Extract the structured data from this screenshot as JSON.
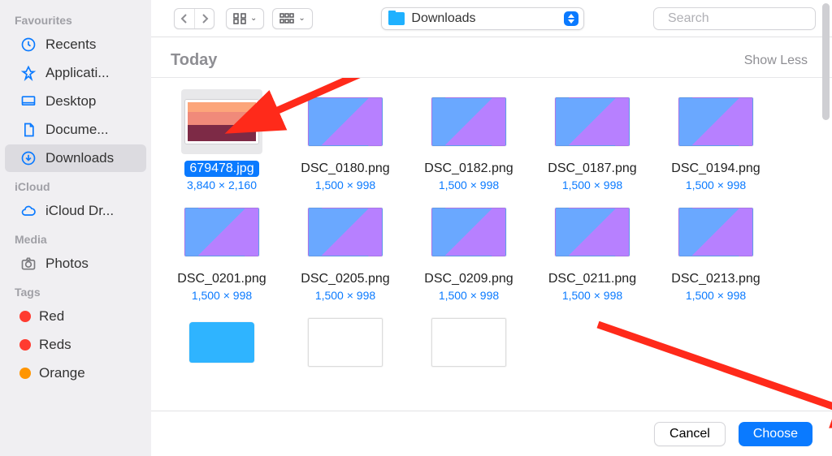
{
  "sidebar": {
    "sections": [
      {
        "label": "Favourites",
        "items": [
          {
            "id": "recents",
            "label": "Recents",
            "icon": "clock"
          },
          {
            "id": "applications",
            "label": "Applicati...",
            "icon": "app"
          },
          {
            "id": "desktop",
            "label": "Desktop",
            "icon": "desktop"
          },
          {
            "id": "documents",
            "label": "Docume...",
            "icon": "doc"
          },
          {
            "id": "downloads",
            "label": "Downloads",
            "icon": "download",
            "selected": true
          }
        ]
      },
      {
        "label": "iCloud",
        "items": [
          {
            "id": "icloud-drive",
            "label": "iCloud Dr...",
            "icon": "cloud"
          }
        ]
      },
      {
        "label": "Media",
        "items": [
          {
            "id": "photos",
            "label": "Photos",
            "icon": "photos",
            "iconColor": "#7a7a7e"
          }
        ]
      },
      {
        "label": "Tags",
        "items": [
          {
            "id": "tag-red",
            "label": "Red",
            "icon": "tag",
            "tagClass": "tag-red"
          },
          {
            "id": "tag-reds",
            "label": "Reds",
            "icon": "tag",
            "tagClass": "tag-reds"
          },
          {
            "id": "tag-orange",
            "label": "Orange",
            "icon": "tag",
            "tagClass": "tag-orange"
          }
        ]
      }
    ]
  },
  "toolbar": {
    "path_label": "Downloads",
    "search_placeholder": "Search"
  },
  "group": {
    "title": "Today",
    "toggle_label": "Show Less"
  },
  "files": [
    {
      "name": "679478.jpg",
      "dim": "3,840 × 2,160",
      "thumb": "sunset",
      "selected": true
    },
    {
      "name": "DSC_0180.png",
      "dim": "1,500 × 998",
      "thumb": "screen"
    },
    {
      "name": "DSC_0182.png",
      "dim": "1,500 × 998",
      "thumb": "screen"
    },
    {
      "name": "DSC_0187.png",
      "dim": "1,500 × 998",
      "thumb": "screen"
    },
    {
      "name": "DSC_0194.png",
      "dim": "1,500 × 998",
      "thumb": "screen"
    },
    {
      "name": "DSC_0201.png",
      "dim": "1,500 × 998",
      "thumb": "screen"
    },
    {
      "name": "DSC_0205.png",
      "dim": "1,500 × 998",
      "thumb": "screen"
    },
    {
      "name": "DSC_0209.png",
      "dim": "1,500 × 998",
      "thumb": "screen"
    },
    {
      "name": "DSC_0211.png",
      "dim": "1,500 × 998",
      "thumb": "screen"
    },
    {
      "name": "DSC_0213.png",
      "dim": "1,500 × 998",
      "thumb": "screen"
    },
    {
      "name": "",
      "dim": "",
      "thumb": "folder"
    },
    {
      "name": "",
      "dim": "",
      "thumb": "doc"
    },
    {
      "name": "",
      "dim": "",
      "thumb": "doc"
    }
  ],
  "footer": {
    "cancel_label": "Cancel",
    "choose_label": "Choose"
  },
  "colors": {
    "accent": "#0a7aff",
    "arrow": "#ff2a1a"
  }
}
